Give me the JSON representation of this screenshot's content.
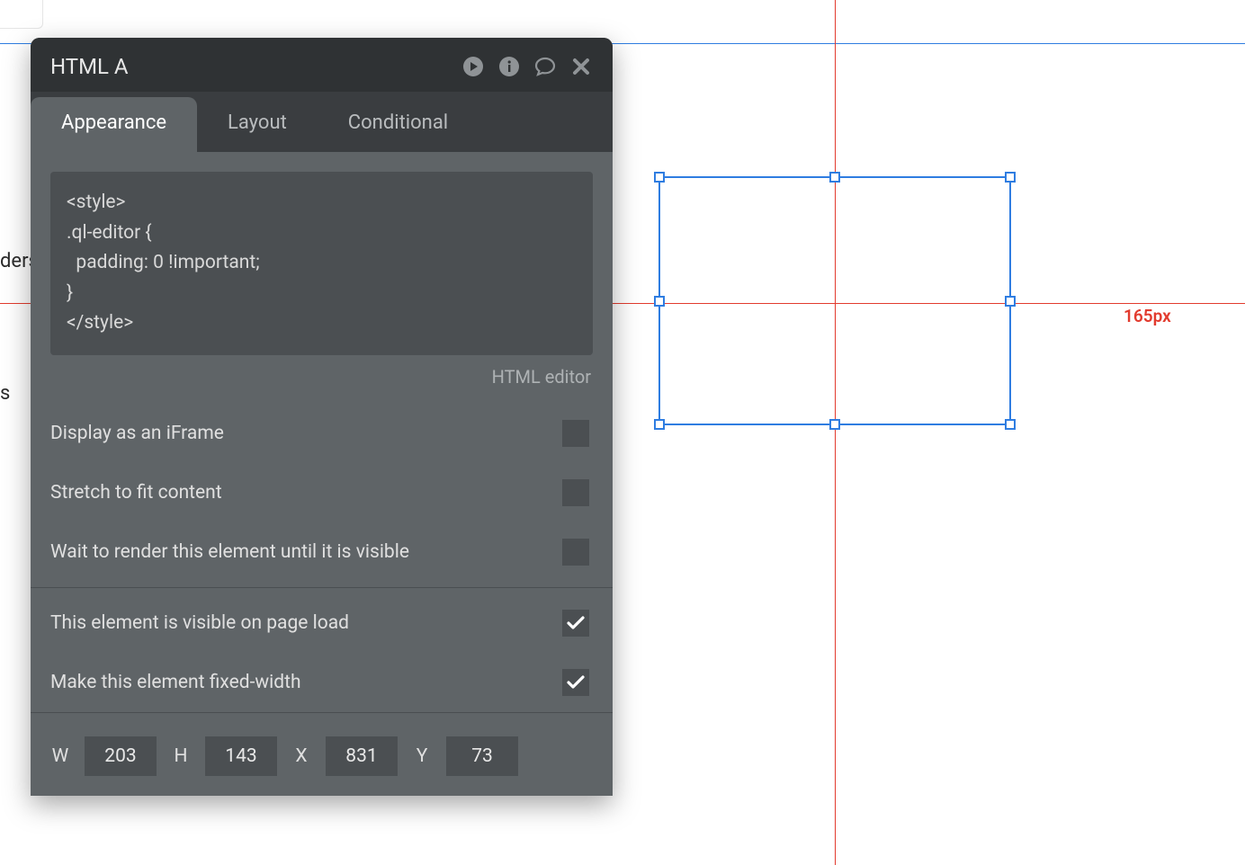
{
  "panel": {
    "title": "HTML A",
    "tabs": {
      "appearance": "Appearance",
      "layout": "Layout",
      "conditional": "Conditional"
    },
    "code": "<style>\n.ql-editor {\n  padding: 0 !important;\n}\n</style>",
    "editor_link": "HTML editor",
    "options": {
      "display_iframe": "Display as an iFrame",
      "stretch": "Stretch to fit content",
      "wait_render": "Wait to render this element until it is visible",
      "visible_on_load": "This element is visible on page load",
      "fixed_width": "Make this element fixed-width"
    },
    "dims": {
      "w_label": "W",
      "w_value": "203",
      "h_label": "H",
      "h_value": "143",
      "x_label": "X",
      "x_value": "831",
      "y_label": "Y",
      "y_value": "73"
    }
  },
  "canvas": {
    "dimension_label": "165px",
    "edge_text_1": "ders",
    "edge_text_2": "s"
  }
}
